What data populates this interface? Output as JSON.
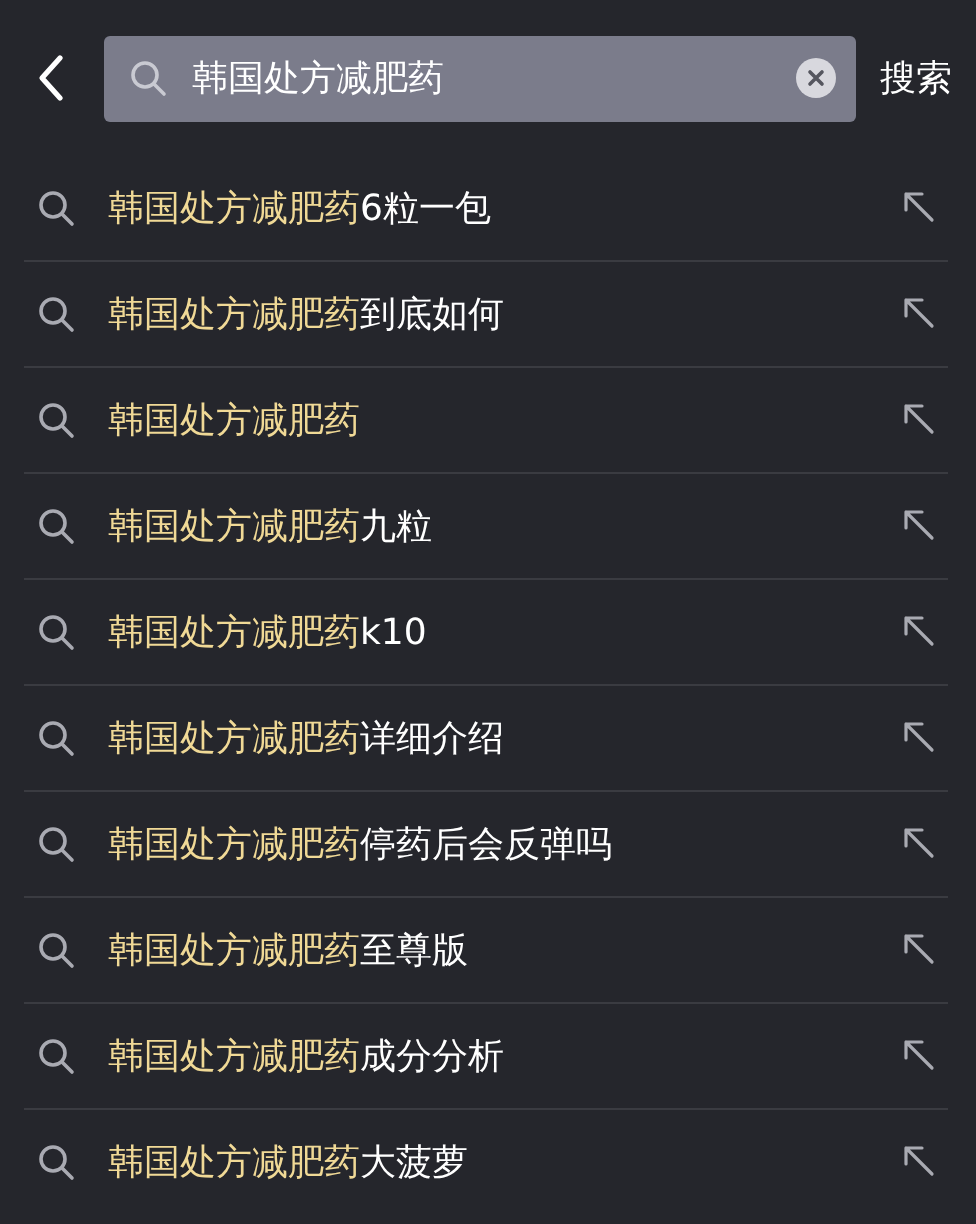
{
  "header": {
    "query": "韩国处方减肥药",
    "search_button": "搜索"
  },
  "suggestions": [
    {
      "match": "韩国处方减肥药",
      "rest": "6粒一包"
    },
    {
      "match": "韩国处方减肥药",
      "rest": "到底如何"
    },
    {
      "match": "韩国处方减肥药"
    },
    {
      "match": "韩国处方减肥药",
      "rest": "九粒"
    },
    {
      "match": "韩国处方减肥药",
      "rest": "k10"
    },
    {
      "match": "韩国处方减肥药",
      "rest": "详细介绍"
    },
    {
      "match": "韩国处方减肥药",
      "rest": "停药后会反弹吗"
    },
    {
      "match": "韩国处方减肥药",
      "rest": "至尊版"
    },
    {
      "match": "韩国处方减肥药",
      "rest": "成分分析"
    },
    {
      "match": "韩国处方减肥药",
      "rest": "大菠萝"
    }
  ]
}
